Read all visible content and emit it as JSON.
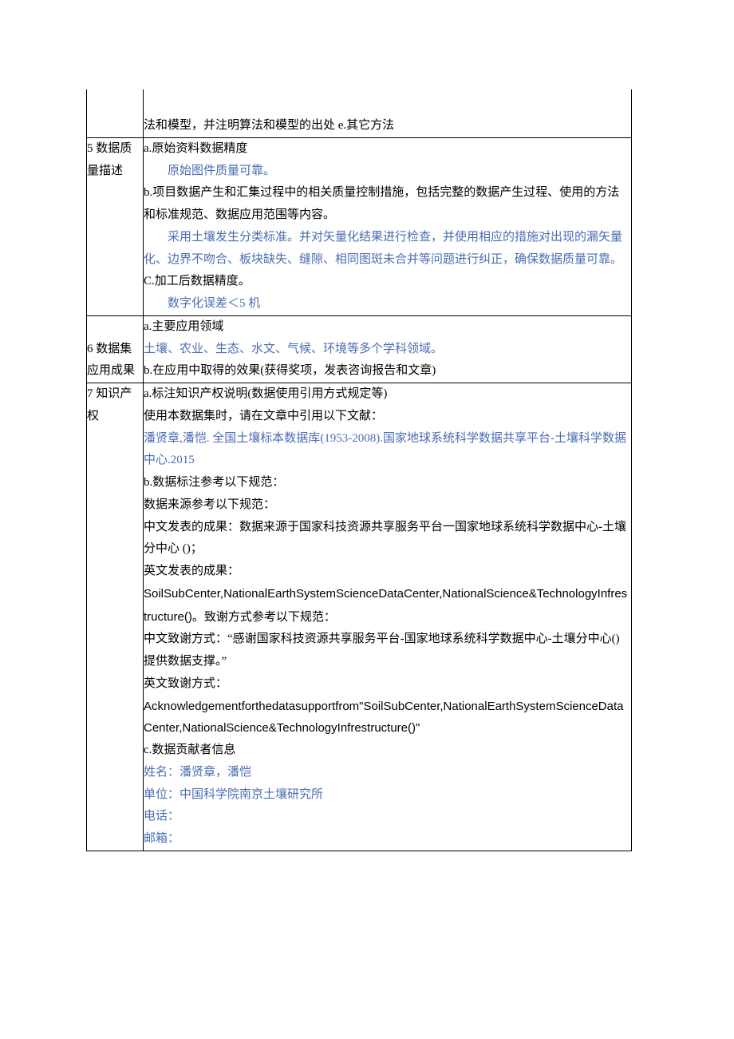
{
  "row4tail": "法和模型，并注明算法和模型的出处 e.其它方法",
  "row5": {
    "label": "5 数据质量描述",
    "a_label": "a.原始资料数据精度",
    "a_value": "原始图件质量可靠。",
    "b_label": "b.项目数据产生和汇集过程中的相关质量控制措施，包括完整的数据产生过程、使用的方法和标准规范、数据应用范围等内容。",
    "b_value": "采用土壤发生分类标准。并对矢量化结果进行检查，并使用相应的措施对出现的漏矢量化、边界不吻合、板块缺失、缝隙、相同图斑未合并等问题进行纠正，确保数据质量可靠。",
    "c_label": "C.加工后数据精度。",
    "c_value": "数字化误差＜5 机"
  },
  "row6": {
    "label": "6 数据集应用成果",
    "a_label": "a.主要应用领域",
    "a_value": "土壤、农业、生态、水文、气候、环境等多个学科领域。",
    "b_label": "b.在应用中取得的效果(获得奖项，发表咨询报告和文章)"
  },
  "row7": {
    "label": "7 知识产权",
    "a_label": "a.标注知识产权说明(数据使用引用方式规定等)",
    "a_line1": "使用本数据集时，请在文章中引用以下文献：",
    "a_citation": "潘贤章,潘恺. 全国土壤标本数据库(1953-2008).国家地球系统科学数据共享平台-土壤科学数据中心.2015",
    "b_label": "b.数据标注参考以下规范：",
    "b_source_ref": "数据来源参考以下规范：",
    "b_cn_source": "中文发表的成果：数据来源于国家科技资源共享服务平台一国家地球系统科学数据中心-土壤分中心 ()；",
    "b_en_label": "英文发表的成果：",
    "b_en_source_1": "SoilSubCenter,NationalEarthSystemScienceDataCenter,NationalScience&TechnologyInfrestructure()",
    "b_en_source_tail": "。致谢方式参考以下规范：",
    "b_cn_ack": "中文致谢方式：“感谢国家科技资源共享服务平台-国家地球系统科学数据中心-土壤分中心()提供数据支撑。”",
    "b_en_ack_label": "英文致谢方式：",
    "b_en_ack": "Acknowledgementforthedatasupportfrom\"SoilSubCenter,NationalEarthSystemScienceDataCenter,NationalScience&TechnologyInfrestructure()\"",
    "c_label": "c.数据贡献者信息",
    "c_name": "姓名：潘贤章，潘恺",
    "c_org": "单位：中国科学院南京土壤研究所",
    "c_tel": "电话：",
    "c_mail": "邮箱："
  }
}
